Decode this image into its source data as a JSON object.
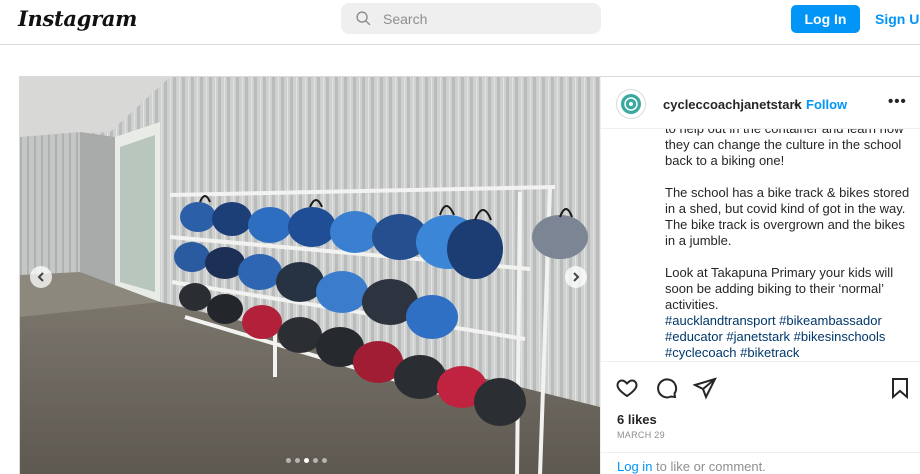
{
  "nav": {
    "logo": "Instagram",
    "search_placeholder": "Search",
    "login_label": "Log In",
    "signup_label": "Sign Up"
  },
  "post": {
    "username": "cycleccoachjanetstark",
    "separator": "•",
    "follow_label": "Follow",
    "more_label": "•••",
    "caption_paragraphs": [
      "to help out in the container and learn how they can change the culture in the school back to a biking one!",
      "The school has a bike track & bikes stored in a shed, but covid kind of got in the way. The bike track is overgrown and the bikes in a jumble.",
      "Look at Takapuna Primary your kids will soon be adding biking to their ‘normal’ activities."
    ],
    "hashtags": "#aucklandtransport #bikeambassador #educator #janetstark #bikesinschools #cyclecoach #biketrack",
    "likes": "6 likes",
    "date": "MARCH 29",
    "login_link": "Log in",
    "login_suffix": " to like or comment.",
    "carousel": {
      "total": 5,
      "active_index": 2
    }
  },
  "icons": {
    "search": "search-icon",
    "like": "heart-icon",
    "comment": "comment-icon",
    "share": "share-icon",
    "save": "bookmark-icon",
    "prev": "chevron-left-icon",
    "next": "chevron-right-icon"
  },
  "colors": {
    "accent": "#0095f6",
    "hashtag": "#00376b",
    "border": "#dbdbdb",
    "muted": "#8e8e8e"
  }
}
